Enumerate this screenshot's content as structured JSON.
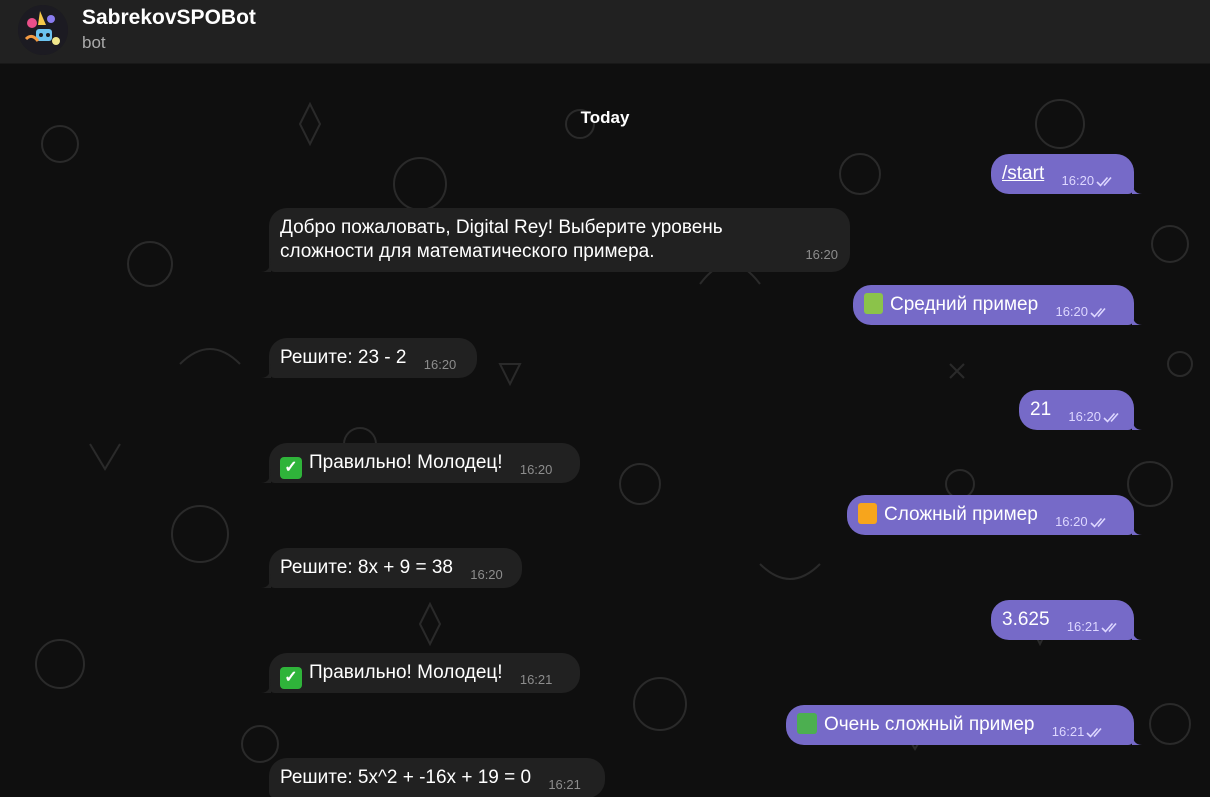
{
  "header": {
    "bot_name": "SabrekovSPOBot",
    "status": "bot",
    "avatar_icon": "space-robot-avatar-icon"
  },
  "chat": {
    "date_separator": "Today",
    "colors": {
      "incoming": "#212121",
      "outgoing": "#766ac8"
    },
    "messages": [
      {
        "dir": "out",
        "text": "/start",
        "time": "16:20"
      },
      {
        "dir": "in",
        "text": "Добро пожаловать, Digital Rey! Выберите уровень сложности для математического примера.",
        "line1": "Добро пожаловать, Digital Rey! Выберите уровень",
        "line2": "сложности для математического примера.",
        "time": "16:20"
      },
      {
        "dir": "out",
        "text": "Средний пример",
        "emoji": "green-book-icon",
        "time": "16:20"
      },
      {
        "dir": "in",
        "text": "Решите: 23 - 2",
        "time": "16:20"
      },
      {
        "dir": "out",
        "text": "21",
        "time": "16:20"
      },
      {
        "dir": "in",
        "text": "Правильно! Молодец!",
        "emoji": "check-mark-icon",
        "time": "16:20"
      },
      {
        "dir": "out",
        "text": "Сложный пример",
        "emoji": "orange-book-icon",
        "time": "16:20"
      },
      {
        "dir": "in",
        "text": "Решите: 8x + 9 = 38",
        "time": "16:20"
      },
      {
        "dir": "out",
        "text": "3.625",
        "time": "16:21"
      },
      {
        "dir": "in",
        "text": "Правильно! Молодец!",
        "emoji": "check-mark-icon",
        "time": "16:21"
      },
      {
        "dir": "out",
        "text": "Очень сложный пример",
        "emoji": "books-icon",
        "time": "16:21"
      },
      {
        "dir": "in",
        "text": "Решите: 5x^2 + -16x + 19 = 0",
        "time": "16:21"
      }
    ]
  }
}
